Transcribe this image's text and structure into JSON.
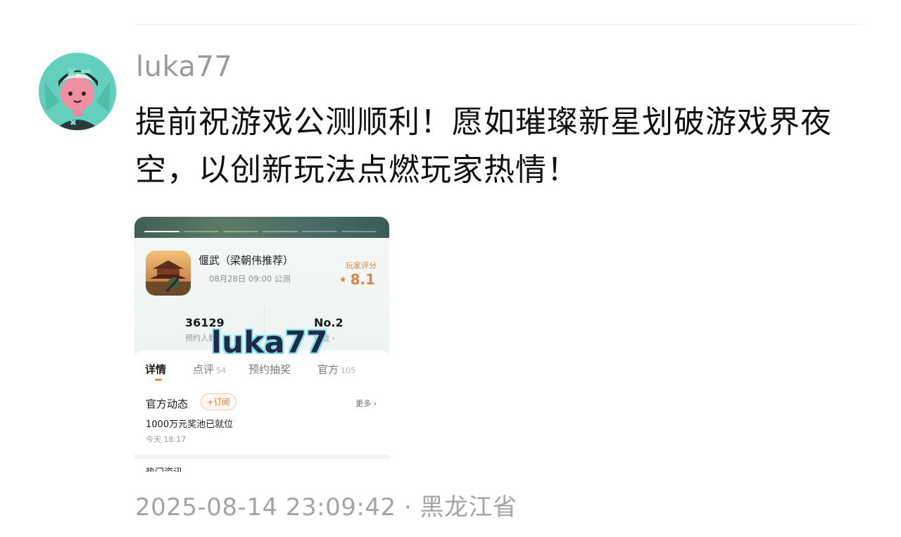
{
  "post": {
    "username": "luka77",
    "comment": "提前祝游戏公测顺利！愿如璀璨新星划破游戏界夜空，以创新玩法点燃玩家热情！",
    "meta": "2025-08-14 23:09:42 · 黑龙江省"
  },
  "screenshot": {
    "game_title": "偃武（梁朝伟推荐）",
    "launch_date": "08月28日 09:00 公测",
    "rating_label": "玩家评分",
    "rating_value": "8.1",
    "stats": [
      {
        "value": "36129",
        "label": "预约人数"
      },
      {
        "value": "No.2",
        "label": "国战 ›"
      }
    ],
    "watermark": "luka77",
    "tabs": [
      {
        "label": "详情",
        "count": ""
      },
      {
        "label": "点评",
        "count": "54"
      },
      {
        "label": "预约抽奖",
        "count": ""
      },
      {
        "label": "官方",
        "count": "105"
      }
    ],
    "news_title": "官方动态",
    "subscribe_label": "+订阅",
    "more_label": "更多 ›",
    "news_body": "1000万元奖池已就位",
    "news_time": "今天 18:17",
    "cut_text": "热门资讯"
  },
  "colors": {
    "accent": "#e07b2f",
    "rating": "#d98545",
    "avatar_bg": "#62d0bd"
  }
}
